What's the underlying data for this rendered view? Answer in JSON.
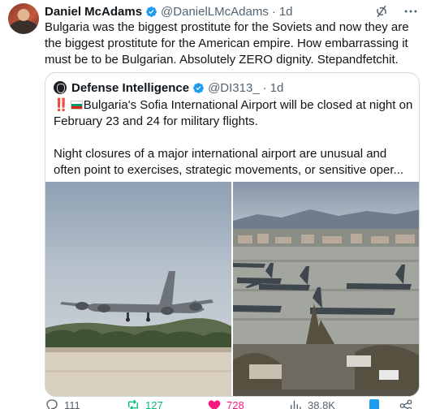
{
  "tweet": {
    "author": {
      "name": "Daniel McAdams",
      "handle": "@DanielLMcAdams",
      "time": "1d"
    },
    "text": "Bulgaria was the biggest prostitute for the Soviets and now they are the biggest prostitute for the American empire. How embarrassing it must be to be Bulgarian. Absolutely ZERO dignity. Stepandfetchit."
  },
  "quote": {
    "author": {
      "name": "Defense Intelligence",
      "handle": "@DI313_",
      "time": "1d"
    },
    "exclaim": "‼️",
    "line1": "Bulgaria's Sofia International Airport will be closed at night on February 23 and 24 for military flights.",
    "line2": "Night closures of a major international airport are unusual and often point to exercises, strategic movements, or sensitive oper..."
  },
  "actions": {
    "replies": "111",
    "reposts": "127",
    "likes": "728",
    "views": "38.8K"
  },
  "colors": {
    "verified": "#1d9bf0",
    "repost": "#00ba7c",
    "like": "#f91880",
    "bookmark": "#1d9bf0",
    "muted": "#536471"
  },
  "icons": [
    "verified-icon",
    "grok-icon",
    "more-icon",
    "reply-icon",
    "repost-icon",
    "like-icon",
    "views-icon",
    "bookmark-icon",
    "share-icon",
    "flag-bulgaria-icon"
  ]
}
